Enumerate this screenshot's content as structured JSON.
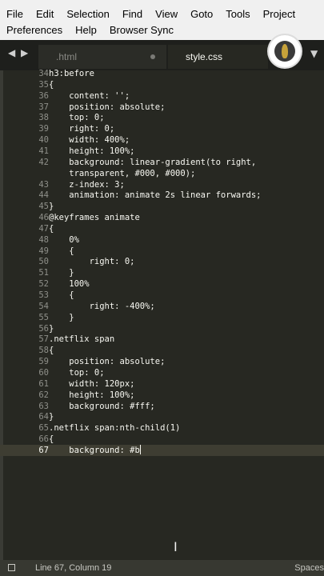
{
  "menu": {
    "row1": [
      "File",
      "Edit",
      "Selection",
      "Find",
      "View",
      "Goto",
      "Tools",
      "Project"
    ],
    "row2": [
      "Preferences",
      "Help",
      "Browser Sync"
    ]
  },
  "tabs": [
    {
      "label": ".html",
      "active": false,
      "modified": true
    },
    {
      "label": "style.css",
      "active": true,
      "modified": false
    }
  ],
  "editor": {
    "lines": [
      {
        "n": "34",
        "text": "h3:before"
      },
      {
        "n": "35",
        "text": "{"
      },
      {
        "n": "36",
        "text": "    content: '';"
      },
      {
        "n": "37",
        "text": "    position: absolute;"
      },
      {
        "n": "38",
        "text": "    top: 0;"
      },
      {
        "n": "39",
        "text": "    right: 0;"
      },
      {
        "n": "40",
        "text": "    width: 400%;"
      },
      {
        "n": "41",
        "text": "    height: 100%;"
      },
      {
        "n": "42",
        "text": "    background: linear-gradient(to right,"
      },
      {
        "n": "",
        "text": "    transparent, #000, #000);"
      },
      {
        "n": "43",
        "text": "    z-index: 3;"
      },
      {
        "n": "44",
        "text": "    animation: animate 2s linear forwards;"
      },
      {
        "n": "45",
        "text": "}"
      },
      {
        "n": "46",
        "text": "@keyframes animate"
      },
      {
        "n": "47",
        "text": "{"
      },
      {
        "n": "48",
        "text": "    0%"
      },
      {
        "n": "49",
        "text": "    {"
      },
      {
        "n": "50",
        "text": "        right: 0;"
      },
      {
        "n": "51",
        "text": "    }"
      },
      {
        "n": "52",
        "text": "    100%"
      },
      {
        "n": "53",
        "text": "    {"
      },
      {
        "n": "54",
        "text": "        right: -400%;"
      },
      {
        "n": "55",
        "text": "    }"
      },
      {
        "n": "56",
        "text": "}"
      },
      {
        "n": "57",
        "text": ".netflix span"
      },
      {
        "n": "58",
        "text": "{"
      },
      {
        "n": "59",
        "text": "    position: absolute;"
      },
      {
        "n": "60",
        "text": "    top: 0;"
      },
      {
        "n": "61",
        "text": "    width: 120px;"
      },
      {
        "n": "62",
        "text": "    height: 100%;"
      },
      {
        "n": "63",
        "text": "    background: #fff;"
      },
      {
        "n": "64",
        "text": "}"
      },
      {
        "n": "65",
        "text": ".netflix span:nth-child(1)"
      },
      {
        "n": "66",
        "text": "{"
      },
      {
        "n": "67",
        "text": "    background: #b"
      }
    ],
    "current_line": "67"
  },
  "status": {
    "position": "Line 67, Column 19",
    "indent": "Spaces"
  },
  "colors": {
    "editor_bg": "#272822",
    "text": "#f8f8f2",
    "line_number": "#8f908a",
    "current_line_bg": "#3e3d32"
  }
}
